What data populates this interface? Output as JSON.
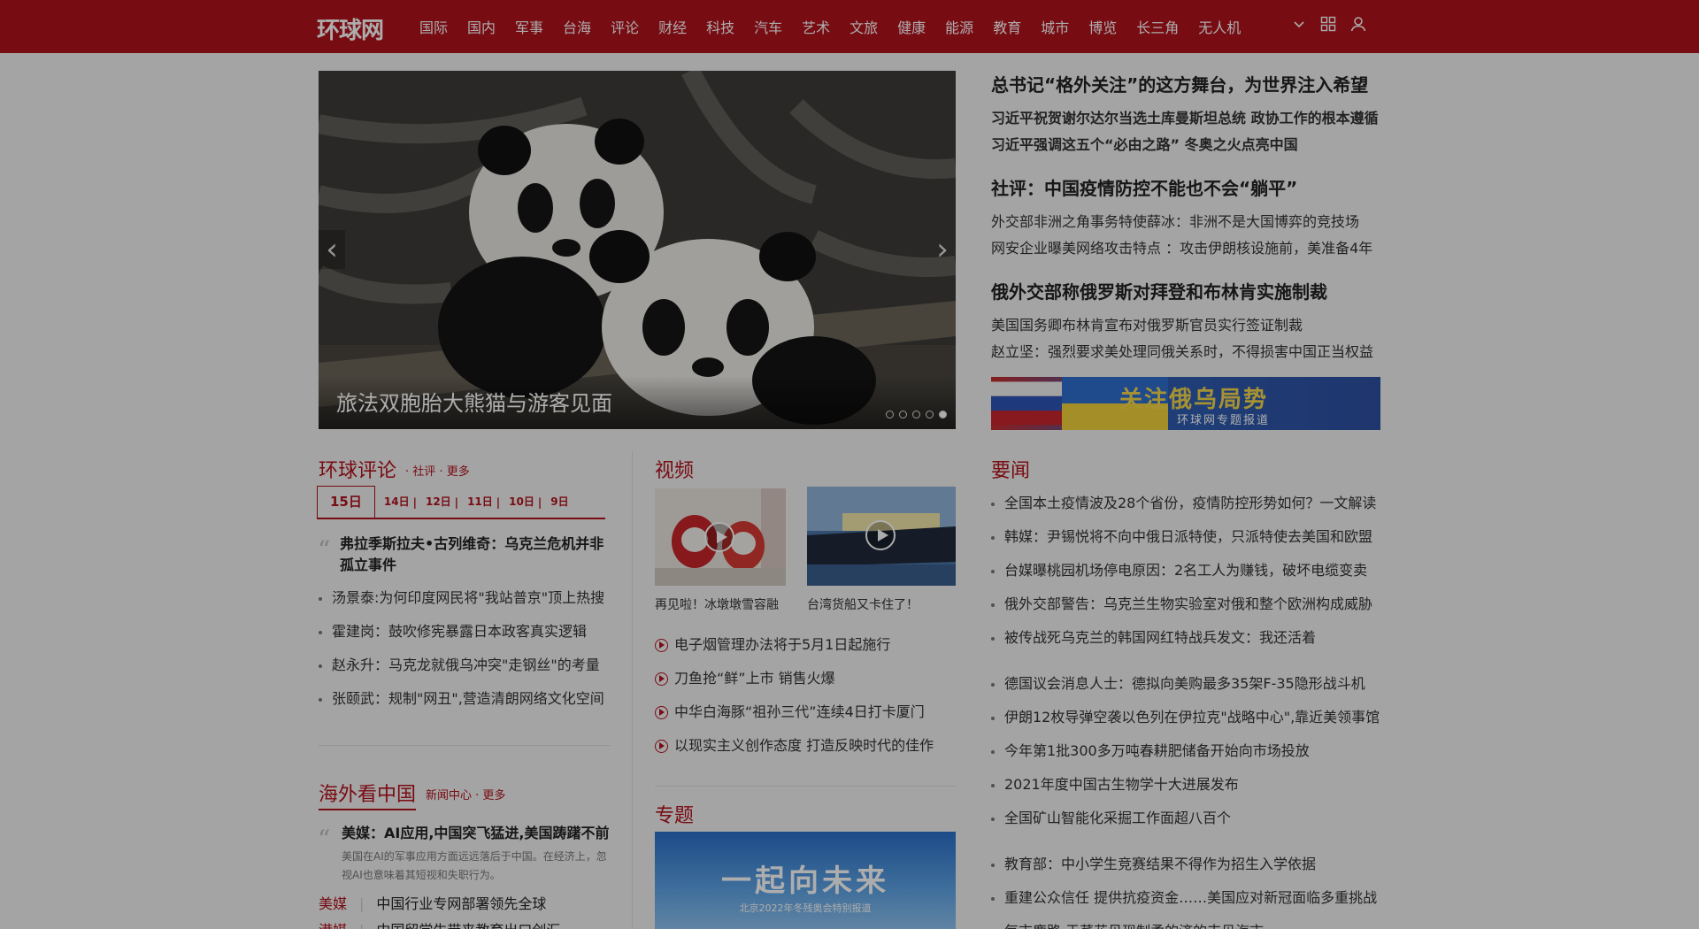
{
  "header": {
    "logo": "环球网",
    "nav": [
      "国际",
      "国内",
      "军事",
      "台海",
      "评论",
      "财经",
      "科技",
      "汽车",
      "艺术",
      "文旅",
      "健康",
      "能源",
      "教育",
      "城市",
      "博览",
      "长三角",
      "无人机"
    ],
    "icons": [
      "chevron-down-icon",
      "apps-grid-icon",
      "user-icon"
    ]
  },
  "slider": {
    "caption": "旅法双胞胎大熊猫与游客见面",
    "dots": 5,
    "active_dot": 5
  },
  "topnews": [
    {
      "title": "总书记“格外关注”的这方舞台，为世界注入希望",
      "items": [
        "习近平祝贺谢尔达尔当选土库曼斯坦总统 政协工作的根本遵循",
        "习近平强调这五个“必由之路” 冬奥之火点亮中国"
      ],
      "bold_items": true
    },
    {
      "title": "社评：中国疫情防控不能也不会“躺平”",
      "items": [
        "外交部非洲之角事务特使薛冰：非洲不是大国博弈的竞技场",
        "网安企业曝美网络攻击特点 ：攻击伊朗核设施前，美准备4年"
      ],
      "bold_items": false
    },
    {
      "title": "俄外交部称俄罗斯对拜登和布林肯实施制裁",
      "items": [
        "美国国务卿布林肯宣布对俄罗斯官员实行签证制裁",
        "赵立坚：强烈要求美处理同俄关系时，不得损害中国正当权益"
      ],
      "bold_items": false
    }
  ],
  "banner": {
    "title": "关注俄乌局势",
    "subtitle": "环球网专题报道"
  },
  "commentary": {
    "title": "环球评论",
    "sub1": "社评",
    "sub2": "更多",
    "dates": [
      "15日",
      "14日",
      "12日",
      "11日",
      "10日",
      "9日"
    ],
    "lead": "弗拉季斯拉夫•古列维奇：乌克兰危机并非孤立事件",
    "items": [
      "汤景泰:为何印度网民将\"我站普京\"顶上热搜",
      "霍建岗：鼓吹修宪暴露日本政客真实逻辑",
      "赵永升：马克龙就俄乌冲突\"走钢丝\"的考量",
      "张颐武：规制\"网丑\",营造清朗网络文化空间"
    ]
  },
  "overseas": {
    "title": "海外看中国",
    "sub1": "新闻中心",
    "sub2": "更多",
    "lead": "美媒：AI应用,中国突飞猛进,美国踌躇不前",
    "abstract": "美国在AI的军事应用方面远远落后于中国。在经济上，忽视AI也意味着其短视和失职行为。",
    "rows": [
      {
        "source": "美媒",
        "text": "中国行业专网部署领先全球"
      },
      {
        "source": "港媒",
        "text": "中国留学生带来教育出口创汇"
      }
    ]
  },
  "video": {
    "title": "视频",
    "thumbs": [
      {
        "caption": "再见啦！冰墩墩雪容融"
      },
      {
        "caption": "台湾货船又卡住了！"
      }
    ],
    "items": [
      "电子烟管理办法将于5月1日起施行",
      "刀鱼抢“鲜”上市 销售火爆",
      "中华白海豚“祖孙三代”连续4日打卡厦门",
      "以现实主义创作态度 打造反映时代的佳作"
    ]
  },
  "special": {
    "title": "专题",
    "banner_title": "一起向未来",
    "banner_sub": "北京2022年冬残奥会特别报道"
  },
  "headlines": {
    "title": "要闻",
    "group1": [
      "全国本土疫情波及28个省份，疫情防控形势如何？一文解读",
      "韩媒：尹锡悦将不向中俄日派特使，只派特使去美国和欧盟",
      "台媒曝桃园机场停电原因：2名工人为赚钱，破坏电缆变卖",
      "俄外交部警告：乌克兰生物实验室对俄和整个欧洲构成威胁",
      "被传战死乌克兰的韩国网红特战兵发文：我还活着"
    ],
    "group2": [
      "德国议会消息人士：德拟向美购最多35架F-35隐形战斗机",
      "伊朗12枚导弹空袭以色列在伊拉克\"战略中心\",靠近美领事馆",
      "今年第1批300多万吨春耕肥储备开始向市场投放",
      "2021年度中国古生物学十大进展发布",
      "全国矿山智能化采掘工作面超八百个"
    ],
    "group3": [
      "教育部：中小学生竞赛结果不得作为招生入学依据",
      "重建公众信任 提供抗疫资金……美国应对新冠面临多重挑战",
      "每市鹿路 于芹花见现制柔的济的丰贝汽市"
    ]
  }
}
